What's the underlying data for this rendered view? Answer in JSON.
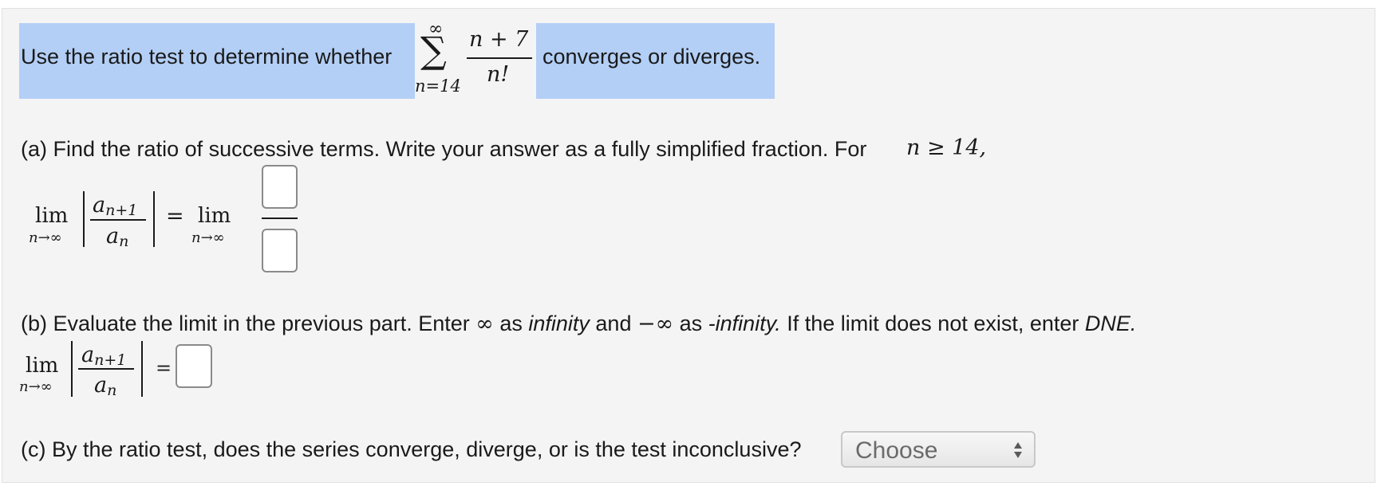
{
  "question": {
    "intro_before": "Use the ratio test to determine whether",
    "intro_after": "converges or diverges.",
    "series": {
      "sum_symbol": "∑",
      "upper_limit": "∞",
      "lower_limit": "n=14",
      "numerator": "n + 7",
      "denominator": "n!"
    }
  },
  "part_a": {
    "text": "(a) Find the ratio of successive terms. Write your answer as a fully simplified fraction. For",
    "condition": "n ≥ 14,",
    "lim": "lim",
    "lim_sub": "n→∞",
    "frac_num": "a",
    "frac_num_sub": "n+1",
    "frac_den": "a",
    "frac_den_sub": "n",
    "equals": "=",
    "numerator_input": "",
    "denominator_input": ""
  },
  "part_b": {
    "label_before": "(b) Evaluate the limit in the previous part. Enter",
    "inf_symbol": "∞",
    "as1": "as",
    "infinity_word": "infinity",
    "and_word": "and",
    "neg_inf_symbol": "−∞",
    "as2": "as",
    "neg_infinity_word": "-infinity.",
    "dne_sentence": "If the limit does not exist, enter",
    "dne_word": "DNE.",
    "lim": "lim",
    "lim_sub": "n→∞",
    "frac_num": "a",
    "frac_num_sub": "n+1",
    "frac_den": "a",
    "frac_den_sub": "n",
    "equals": "=",
    "answer_input": ""
  },
  "part_c": {
    "text": "(c) By the ratio test, does the series converge, diverge, or is the test inconclusive?",
    "select_value": "Choose",
    "select_arrow": "▲▼"
  },
  "colors": {
    "highlight": "#b3cff6",
    "background": "#f4f4f4"
  },
  "icons": {
    "select_arrow": "updown-arrows-icon"
  }
}
